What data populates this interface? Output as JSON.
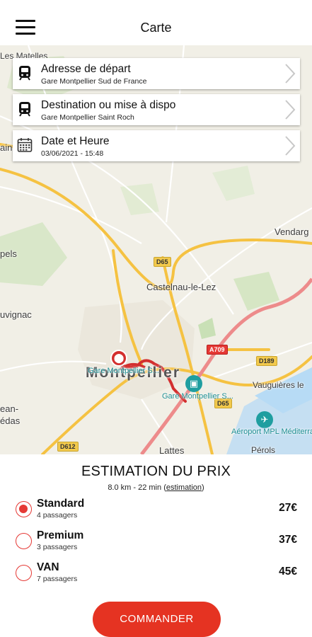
{
  "header": {
    "title": "Carte",
    "menu_icon": "hamburger-menu-icon"
  },
  "map": {
    "labels": {
      "les_matelles": "Les Matelles",
      "ain": "ain",
      "pels": "pels",
      "uvignac": "uvignac",
      "ean": "ean-",
      "edas": "édas",
      "vendarg": "Vendarg",
      "castelnau": "Castelnau-le-Lez",
      "montpellier": "Montpellier",
      "vauguieres": "Vauguières le",
      "lattes": "Lattes",
      "perols": "Pérols",
      "gare_sud": "Gare Montpellier S...",
      "gare_st_roch": "Gare Montpellier S...",
      "aeroport": "Aéroport MPL Méditerranée"
    },
    "roads": {
      "d65_a": "D65",
      "d65_b": "D65",
      "a709": "A709",
      "d189": "D189",
      "d612": "D612"
    },
    "colors": {
      "route": "#d32f2f",
      "station": "#1f9ea0",
      "land": "#f1efe6",
      "green": "#cfe4bd",
      "water": "#b7dbf5",
      "major_road": "#f5c242"
    }
  },
  "cards": [
    {
      "icon": "train-icon",
      "title": "Adresse de départ",
      "subtitle": "Gare Montpellier Sud de France"
    },
    {
      "icon": "train-icon",
      "title": "Destination ou mise à dispo",
      "subtitle": "Gare Montpellier Saint Roch"
    },
    {
      "icon": "calendar-icon",
      "title": "Date et Heure",
      "subtitle": "03/06/2021 - 15:48"
    }
  ],
  "estimation": {
    "title": "ESTIMATION DU PRIX",
    "summary": "8.0 km - 22 min",
    "link": "estimation",
    "paren_open": "(",
    "paren_close": ")"
  },
  "options": [
    {
      "name": "Standard",
      "capacity": "4 passagers",
      "price": "27€",
      "selected": true
    },
    {
      "name": "Premium",
      "capacity": "3 passagers",
      "price": "37€",
      "selected": false
    },
    {
      "name": "VAN",
      "capacity": "7 passagers",
      "price": "45€",
      "selected": false
    }
  ],
  "order_button": "COMMANDER",
  "colors": {
    "accent": "#e53322"
  }
}
